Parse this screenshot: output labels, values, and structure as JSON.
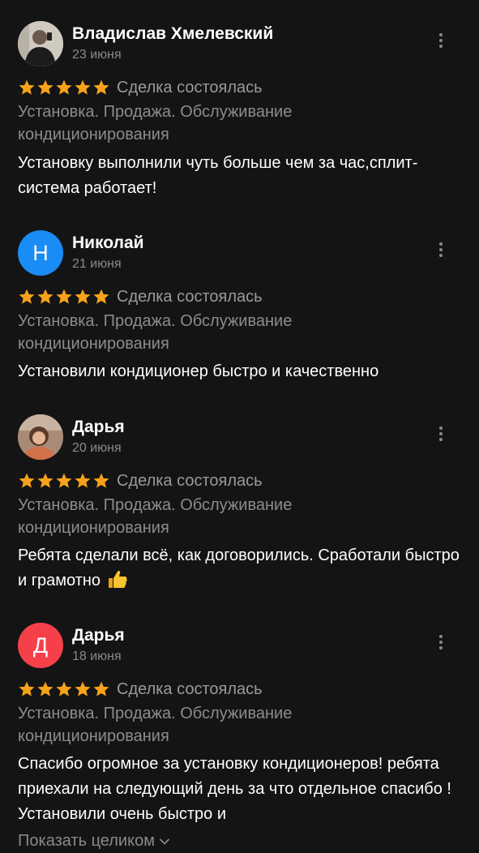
{
  "reviews": [
    {
      "name": "Владислав Хмелевский",
      "date": "23 июня",
      "avatar": {
        "type": "photo",
        "icon": "user-photo-man"
      },
      "rating": 5,
      "deal": "Сделка состоялась",
      "service": "Установка. Продажа. Обслуживание кондиционирования",
      "text": "Установку выполнили чуть больше чем за час,сплит-система работает!"
    },
    {
      "name": "Николай",
      "date": "21 июня",
      "avatar": {
        "type": "letter",
        "letter": "Н",
        "color": "#1a8cf5"
      },
      "rating": 5,
      "deal": "Сделка состоялась",
      "service": "Установка. Продажа. Обслуживание кондиционирования",
      "text": "Установили кондиционер быстро и качественно"
    },
    {
      "name": "Дарья",
      "date": "20 июня",
      "avatar": {
        "type": "photo",
        "icon": "user-photo-woman"
      },
      "rating": 5,
      "deal": "Сделка состоялась",
      "service": "Установка. Продажа. Обслуживание кондиционирования",
      "text": "Ребята сделали всё, как договорились. Сработали быстро и грамотно",
      "emoji": "thumbs-up-icon"
    },
    {
      "name": "Дарья",
      "date": "18 июня",
      "avatar": {
        "type": "letter",
        "letter": "Д",
        "color": "#f5404a"
      },
      "rating": 5,
      "deal": "Сделка состоялась",
      "service": "Установка. Продажа. Обслуживание кондиционирования",
      "text": "Спасибо огромное за установку кондиционеров! ребята приехали на следующий день за что отдельное спасибо ! Установили очень быстро и"
    }
  ],
  "show_more_label": "Показать целиком",
  "colors": {
    "background": "#141414",
    "star": "#f7a21b",
    "muted": "#8c8c8c"
  }
}
